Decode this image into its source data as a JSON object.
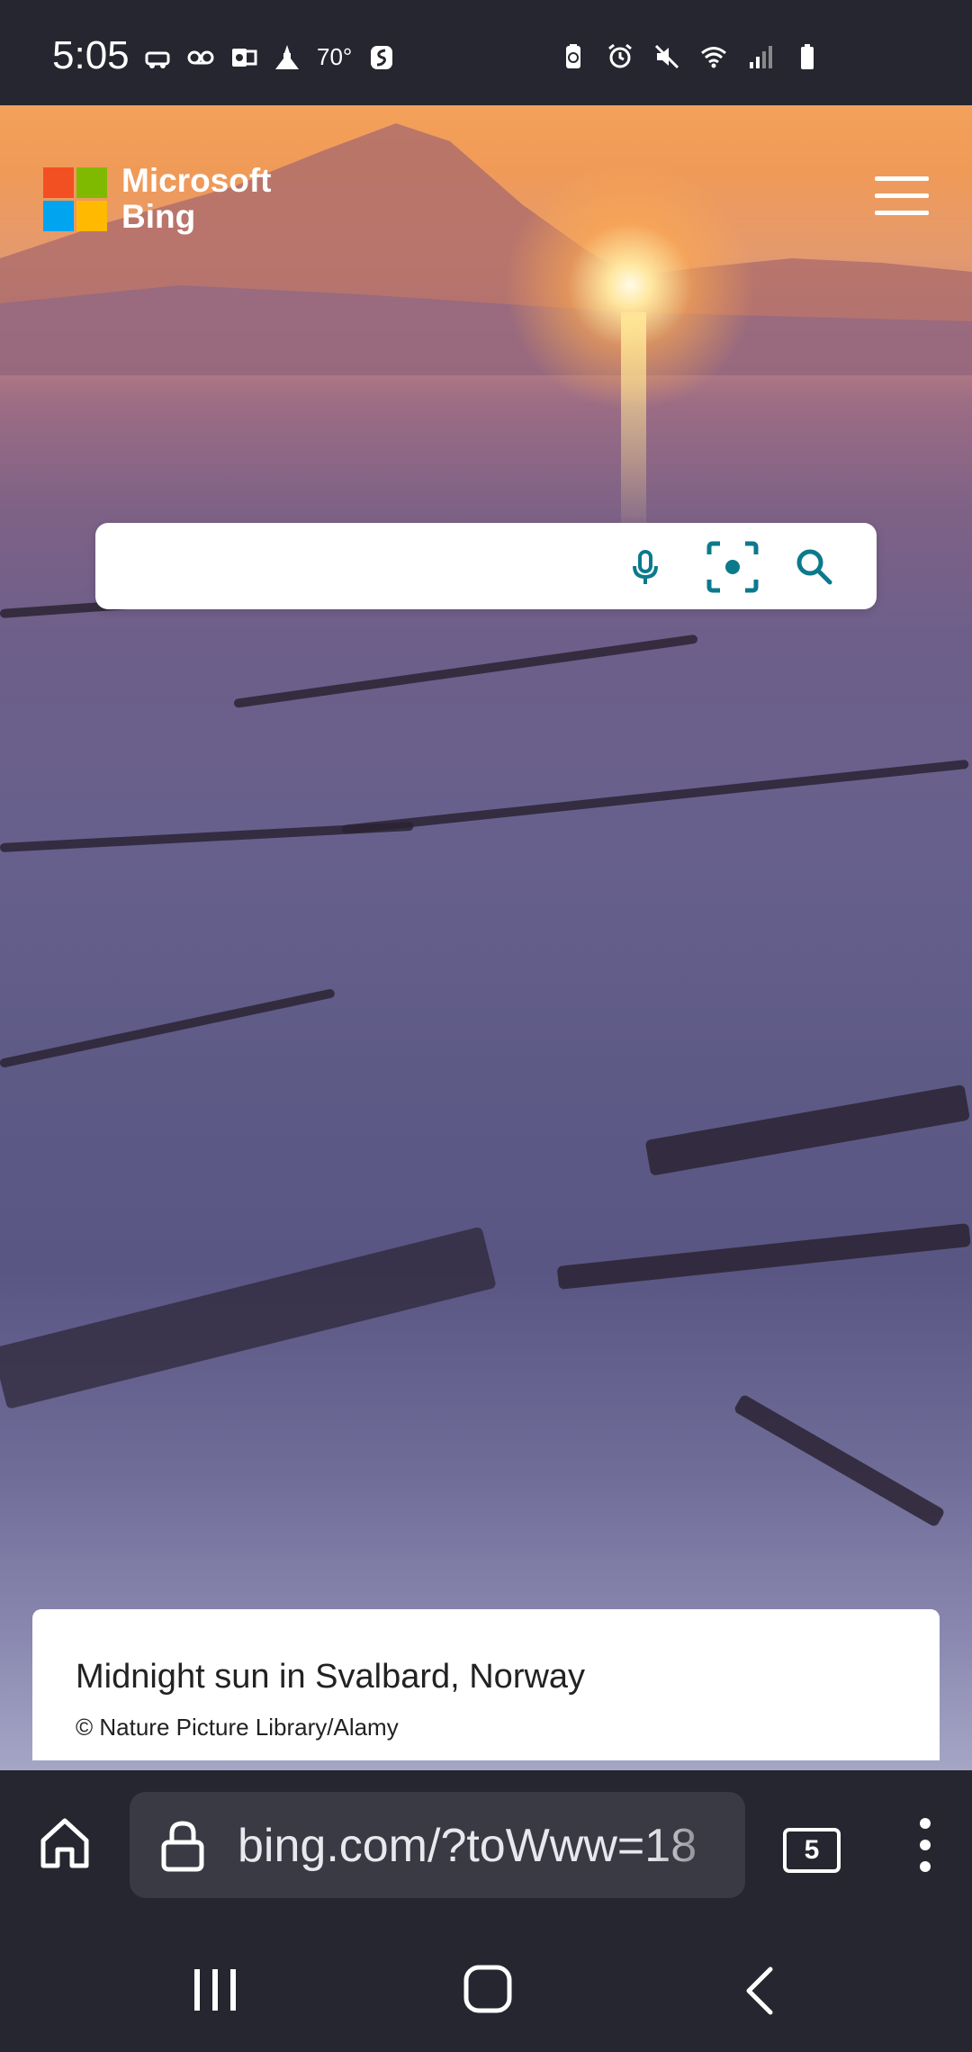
{
  "status_bar": {
    "time": "5:05",
    "temperature": "70°",
    "left_icons": [
      "car-notification-icon",
      "voicemail-icon",
      "outlook-icon",
      "church-icon"
    ],
    "right_icons": [
      "battery-saver-icon",
      "alarm-icon",
      "mute-icon",
      "wifi-icon",
      "signal-icon",
      "battery-icon"
    ]
  },
  "header": {
    "logo_line1": "Microsoft",
    "logo_line2": "Bing",
    "menu_icon": "hamburger-menu-icon"
  },
  "search": {
    "placeholder": "",
    "value": "",
    "icons": [
      "microphone-icon",
      "visual-search-icon",
      "search-icon"
    ],
    "accent_color": "#0b7a8c"
  },
  "image_caption": {
    "title": "Midnight sun in Svalbard, Norway",
    "credit": "© Nature Picture Library/Alamy"
  },
  "browser_toolbar": {
    "url": "bing.com/?toWww=18",
    "tab_count": "5",
    "icons": [
      "home-icon",
      "lock-icon",
      "tabs-icon",
      "more-options-icon"
    ]
  },
  "nav_bar": {
    "icons": [
      "recent-apps-icon",
      "home-button-icon",
      "back-icon"
    ]
  },
  "colors": {
    "ms_red": "#f25022",
    "ms_green": "#7fba00",
    "ms_blue": "#00a4ef",
    "ms_yellow": "#ffb900",
    "chrome_dark": "#262630"
  }
}
